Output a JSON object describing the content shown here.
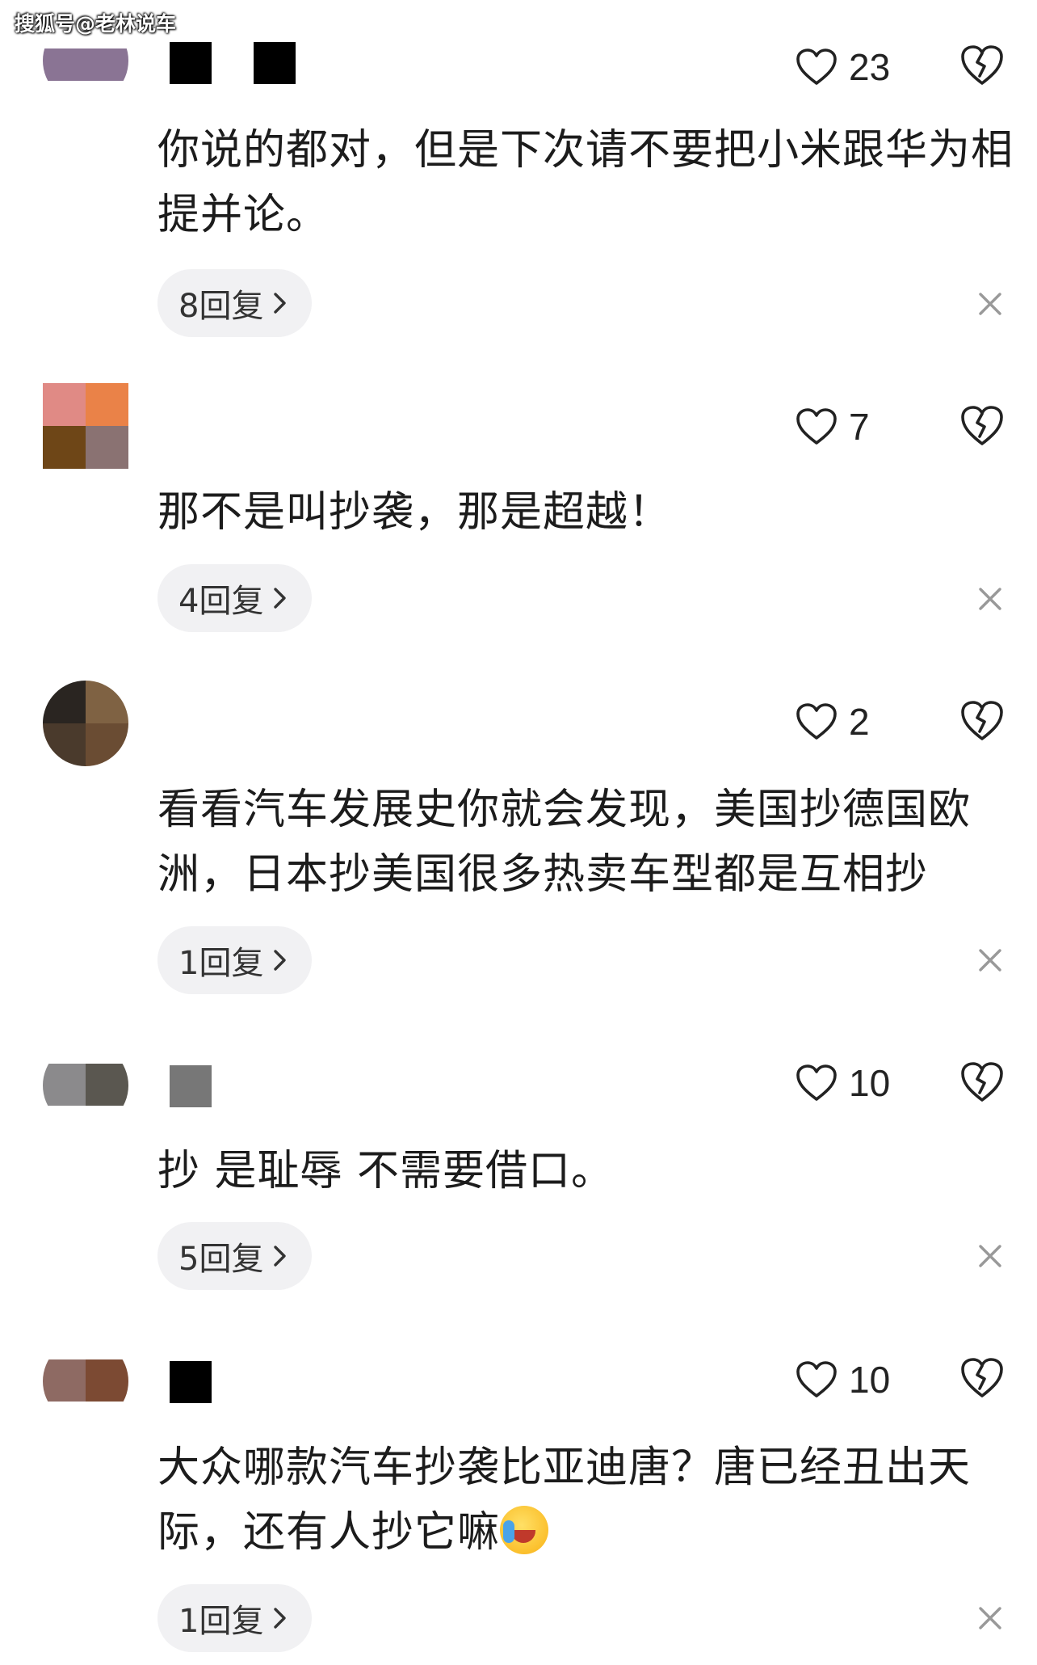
{
  "watermark": "搜狐号@老林说车",
  "comments": [
    {
      "likes": "23",
      "text": "你说的都对，但是下次请不要把小米跟华为相提并论。",
      "replies": "8回复"
    },
    {
      "likes": "7",
      "text": "那不是叫抄袭，那是超越！",
      "replies": "4回复"
    },
    {
      "likes": "2",
      "text": "看看汽车发展史你就会发现，美国抄德国欧洲，日本抄美国很多热卖车型都是互相抄",
      "replies": "1回复"
    },
    {
      "likes": "10",
      "text": "抄 是耻辱 不需要借口。",
      "replies": "5回复"
    },
    {
      "likes": "10",
      "text": "大众哪款汽车抄袭比亚迪唐？唐已经丑出天际，还有人抄它嘛",
      "replies": "1回复"
    }
  ],
  "icons": {
    "like": "heart-outline-icon",
    "dislike": "broken-heart-icon",
    "close": "close-icon",
    "chevron": "chevron-right-icon"
  }
}
